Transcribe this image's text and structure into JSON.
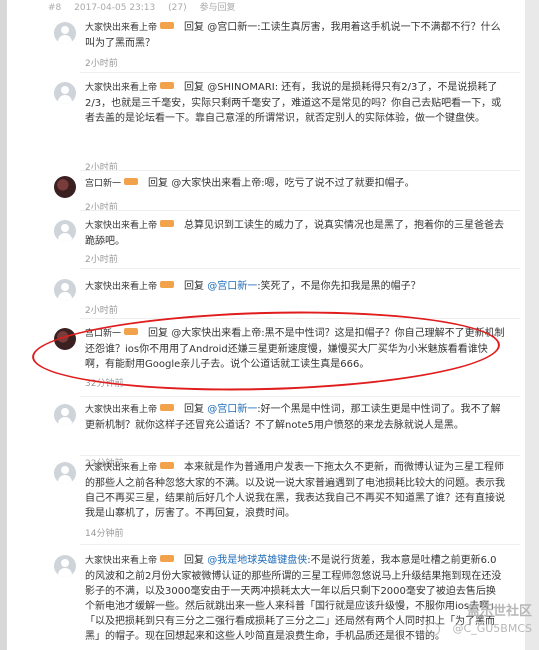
{
  "header": {
    "floor": "#8",
    "date": "2017-04-05 23:13",
    "likes": "(27)",
    "reply_label": "参与回复"
  },
  "comments": [
    {
      "author": "大家快出来看上帝",
      "avatar": "default-avatar",
      "text_pre": "回复 @宫口新一:工读生真厉害，我用着这手机说一下不满都不行？什么叫为了黑而黑？",
      "mention": "",
      "text_post": "",
      "time": "2小时前"
    },
    {
      "author": "大家快出来看上帝",
      "avatar": "default-avatar",
      "text_pre": "回复 @SHINOMARI: 还有，我说的是损耗得只有2/3了，不是说损耗了2/3，也就是三千毫安，实际只剩两千毫安了，难道这不是常见的吗？你自己去贴吧看一下，或者去盖的是论坛看一下。靠自己意淫的所谓常识，就否定别人的实际体验，做一个键盘侠。",
      "mention": "",
      "text_post": "",
      "time": "2小时前"
    },
    {
      "author": "宫口新一",
      "avatar": "user-avatar",
      "text_pre": "回复 @大家快出来看上帝:嗯，吃亏了说不过了就要扣帽子。",
      "mention": "",
      "text_post": "",
      "time": "2小时前"
    },
    {
      "author": "大家快出来看上帝",
      "avatar": "default-avatar",
      "text_pre": "总算见识到工读生的威力了，说真实情况也是黑了，抱着你的三星爸爸去跪舔吧。",
      "mention": "",
      "text_post": "",
      "time": "2小时前"
    },
    {
      "author": "大家快出来看上帝",
      "avatar": "default-avatar",
      "text_pre": "回复 ",
      "mention": "@宫口新一",
      "text_post": ":笑死了，不是你先扣我是黑的帽子？",
      "time": "2小时前"
    },
    {
      "author": "宫口新一",
      "avatar": "user-avatar",
      "text_pre": "回复 @大家快出来看上帝:黑不是中性词？这是扣帽子？你自己理解不了更新机制还怨谁？ios你不用用了Android还嫌三星更新速度慢，嫌慢买大厂买华为小米魅族看看谁快啊，有能耐用Google亲儿子去。说个公道话就工读生真是666。",
      "mention": "",
      "text_post": "",
      "time": "32分钟前"
    },
    {
      "author": "大家快出来看上帝",
      "avatar": "default-avatar",
      "text_pre": "回复 ",
      "mention": "@宫口新一",
      "text_post": ":好一个黑是中性词，那工读生更是中性词了。我不了解更新机制？就你这样子还冒充公道话？不了解note5用户愤怒的来龙去脉就说人是黑。",
      "time": "22分钟前"
    },
    {
      "author": "大家快出来看上帝",
      "avatar": "default-avatar",
      "text_pre": "本来就是作为普通用户发表一下拖太久不更新，而微博认证为三星工程师的那些人之前各种忽悠大家的不满。以及说一说大家普遍遇到了电池损耗比较大的问题。表示我自己不再买三星，结果前后好几个人说我在黑，我表达我自己不再买不知道黑了谁？还有直接说我是山寨机了，厉害了。不再回复，浪费时间。",
      "mention": "",
      "text_post": "",
      "time": "14分钟前"
    },
    {
      "author": "大家快出来看上帝",
      "avatar": "default-avatar",
      "text_pre": "回复 ",
      "mention": "@我是地球英雄键盘侠",
      "text_post": ":不是说行货差，我本意是吐槽之前更新6.0的风波和之前2月份大家被微博认证的那些所谓的三星工程师忽悠说马上升级结果拖到现在还没影子的不满，以及3000毫安由于一天两冲损耗太大一年以后只剩下2000毫安了被迫去售后换个新电池才缓解一些。然后就跳出来一些人来科普「国行就是应该升级慢，不服你用ios去啊」「以及把损耗到只有三分之二强行看成损耗了三分之二」还局然有两个人同时扣上「为了黑而黑」的帽子。现在回想起来和这些人吵简直是浪费生命，手机品质还是很不错的。",
      "time": ""
    }
  ],
  "watermark": {
    "title": "盖乐世社区",
    "handle": "@C_GU5BMCS"
  }
}
